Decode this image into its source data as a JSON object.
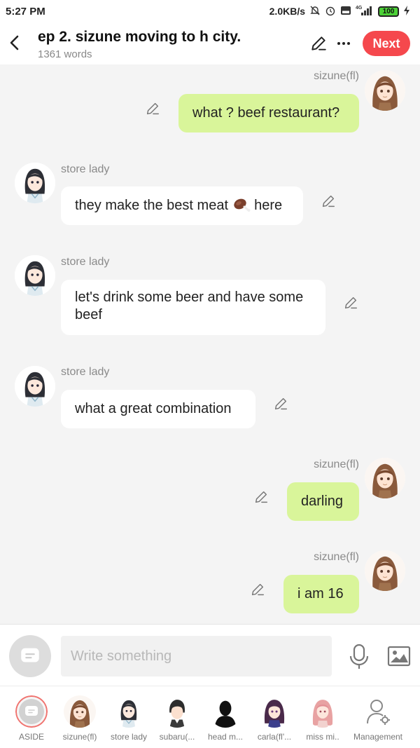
{
  "status_bar": {
    "time": "5:27 PM",
    "speed": "2.0KB/s",
    "network": "4G",
    "battery": "100"
  },
  "header": {
    "title": "ep 2. sizune moving to h city.",
    "word_count": "1361 words",
    "next_label": "Next"
  },
  "messages": [
    {
      "speaker": "sizune(fl)",
      "text": "what ? beef restaurant?",
      "side": "right"
    },
    {
      "speaker": "store lady",
      "text_before": "they make the best meat ",
      "text_after": " here",
      "side": "left"
    },
    {
      "speaker": "store lady",
      "text": "let's drink some beer and have some beef",
      "side": "left"
    },
    {
      "speaker": "store lady",
      "text": "what a great combination",
      "side": "left"
    },
    {
      "speaker": "sizune(fl)",
      "text": "darling",
      "side": "right"
    },
    {
      "speaker": "sizune(fl)",
      "text": "i am 16",
      "side": "right"
    }
  ],
  "input": {
    "placeholder": "Write something"
  },
  "characters": [
    {
      "label": "ASIDE"
    },
    {
      "label": "sizune(fl)"
    },
    {
      "label": "store lady"
    },
    {
      "label": "subaru(..."
    },
    {
      "label": "head m..."
    },
    {
      "label": "carla(fl'..."
    },
    {
      "label": "miss mi.."
    },
    {
      "label": "Management"
    }
  ],
  "colors": {
    "accent": "#f5484d",
    "my_bubble": "#d9f59a",
    "their_bubble": "#ffffff",
    "aside_ring": "#f0736f"
  }
}
